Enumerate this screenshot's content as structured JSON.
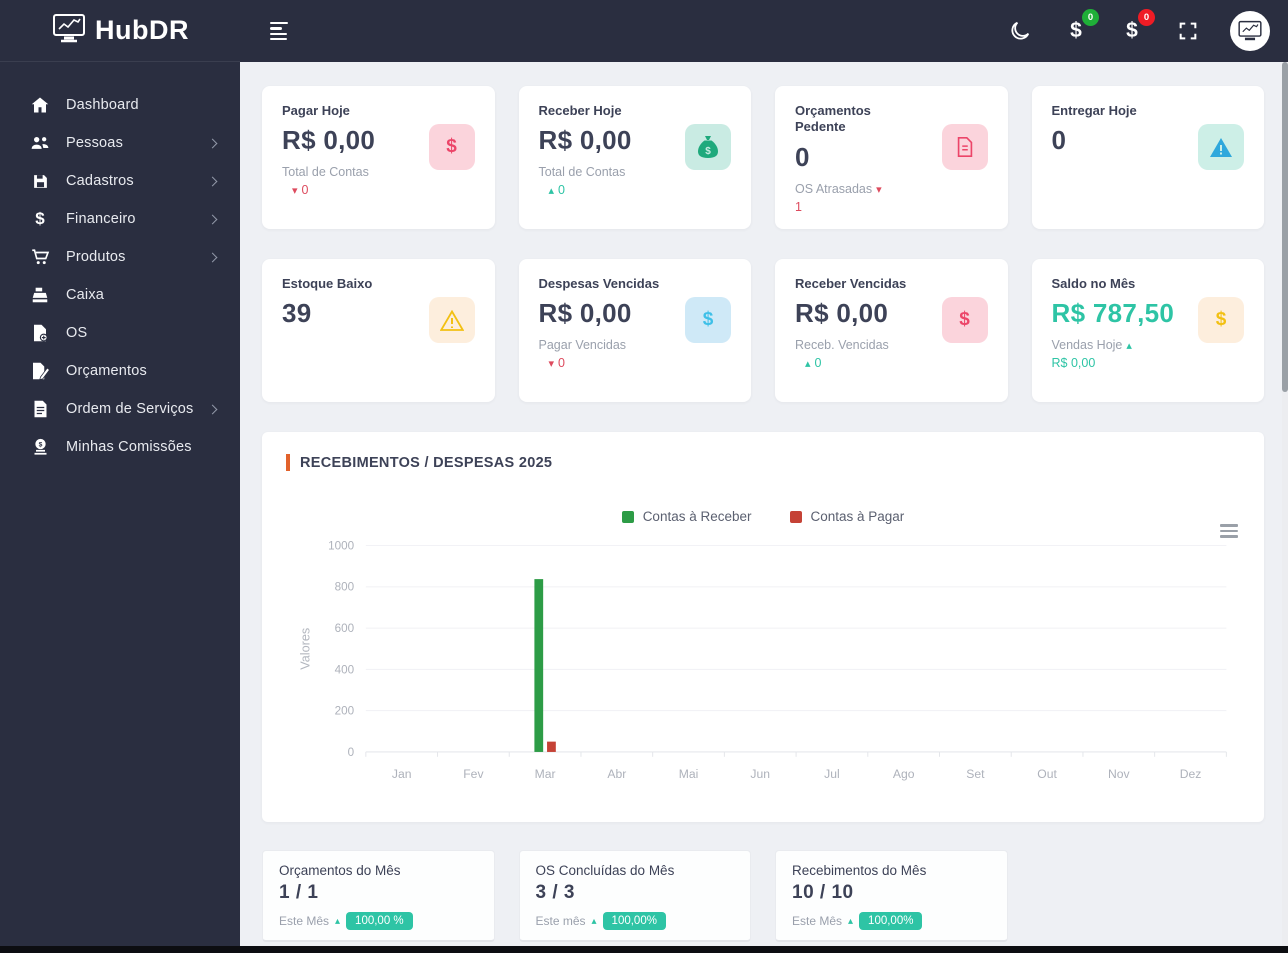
{
  "colors": {
    "header-bg": "#2a2e40",
    "page-bg": "#eef0f4",
    "text-dark": "#3d4257",
    "text-gray": "#9aa0ac",
    "teal": "#2ec4a5",
    "red": "#dd4b5e",
    "accent-orange": "#e2622b",
    "badge-green": "#1faf38",
    "badge-red": "#ef1c25",
    "tile-pink-bg": "#fbd4dc",
    "tile-pink-fg": "#ec4569",
    "tile-teal-bg": "#c9ebe3",
    "tile-teal-fg": "#1fa97c",
    "tile-mint-bg": "#cdefe7",
    "tile-blue-fg": "#2fa8dc",
    "tile-cream-bg": "#fdeedd",
    "tile-yellow-fg": "#f2c013",
    "tile-sky-bg": "#cfe9f7",
    "tile-cyan-fg": "#3fc0e8"
  },
  "sidebar": {
    "logo_text": "HubDR",
    "items": [
      {
        "label": "Dashboard",
        "icon": "home-icon"
      },
      {
        "label": "Pessoas",
        "icon": "users-icon"
      },
      {
        "label": "Cadastros",
        "icon": "save-icon"
      },
      {
        "label": "Financeiro",
        "icon": "dollar-icon",
        "glyph": "$"
      },
      {
        "label": "Produtos",
        "icon": "cart-icon"
      },
      {
        "label": "Caixa",
        "icon": "cash-register-icon"
      },
      {
        "label": "OS",
        "icon": "file-plus-icon"
      },
      {
        "label": "Orçamentos",
        "icon": "file-pen-icon"
      },
      {
        "label": "Ordem de Serviços",
        "icon": "file-lines-icon"
      },
      {
        "label": "Minhas Comissões",
        "icon": "commission-icon"
      }
    ]
  },
  "topbar": {
    "receivable_dollar": "$",
    "receivable_badge": "0",
    "payable_dollar": "$",
    "payable_badge": "0"
  },
  "stats": [
    {
      "title": "Pagar Hoje",
      "value": "R$ 0,00",
      "icon": "dollar-icon",
      "glyph": "$",
      "sub": {
        "label": "Total de Contas",
        "label_arrow": "",
        "value_arrow": "▾",
        "value": "0"
      }
    },
    {
      "title": "Receber Hoje",
      "value": "R$ 0,00",
      "icon": "money-bag-icon",
      "sub": {
        "label": "Total de Contas",
        "label_arrow": "",
        "value_arrow": "▴",
        "value": "0"
      }
    },
    {
      "title": "Orçamentos Pedente",
      "value": "0",
      "icon": "file-icon",
      "sub": {
        "label": "OS Atrasadas",
        "label_arrow": "▾",
        "value_arrow": "",
        "value": "1"
      }
    },
    {
      "title": "Entregar Hoje",
      "value": "0",
      "icon": "warning-icon"
    },
    {
      "title": "Estoque Baixo",
      "value": "39",
      "icon": "warning-icon"
    },
    {
      "title": "Despesas Vencidas",
      "value": "R$ 0,00",
      "icon": "dollar-icon",
      "glyph": "$",
      "sub": {
        "label": "Pagar Vencidas",
        "label_arrow": "",
        "value_arrow": "▾",
        "value": "0"
      }
    },
    {
      "title": "Receber Vencidas",
      "value": "R$ 0,00",
      "icon": "dollar-icon",
      "glyph": "$",
      "sub": {
        "label": "Receb. Vencidas",
        "label_arrow": "",
        "value_arrow": "▴",
        "value": "0"
      }
    },
    {
      "title": "Saldo no Mês",
      "value": "R$ 787,50",
      "icon": "dollar-icon",
      "glyph": "$",
      "sub": {
        "label": "Vendas Hoje",
        "label_arrow": "▴",
        "value_arrow": "",
        "value": "R$ 0,00"
      }
    }
  ],
  "chart": {
    "title": "RECEBIMENTOS / DESPESAS 2025",
    "chart_data": {
      "type": "bar",
      "categories": [
        "Jan",
        "Fev",
        "Mar",
        "Abr",
        "Mai",
        "Jun",
        "Jul",
        "Ago",
        "Set",
        "Out",
        "Nov",
        "Dez"
      ],
      "series": [
        {
          "name": "Contas à Receber",
          "color": "#2d9c46",
          "values": [
            0,
            0,
            837.5,
            0,
            0,
            0,
            0,
            0,
            0,
            0,
            0,
            0
          ]
        },
        {
          "name": "Contas à Pagar",
          "color": "#c54236",
          "values": [
            0,
            0,
            50,
            0,
            0,
            0,
            0,
            0,
            0,
            0,
            0,
            0
          ]
        }
      ],
      "ylabel": "Valores",
      "ylim": [
        0,
        1000
      ],
      "yticks": [
        0,
        200,
        400,
        600,
        800,
        1000
      ],
      "grid": true,
      "legend_position": "top-center"
    }
  },
  "bottom_cards": [
    {
      "title": "Orçamentos do Mês",
      "value": "1 / 1",
      "period": "Este Mês",
      "arrow": "▴",
      "badge": "100,00 %"
    },
    {
      "title": "OS Concluídas do Mês",
      "value": "3 / 3",
      "period": "Este mês",
      "arrow": "▴",
      "badge": "100,00%"
    },
    {
      "title": "Recebimentos do Mês",
      "value": "10 / 10",
      "period": "Este Mês",
      "arrow": "▴",
      "badge": "100,00%"
    }
  ]
}
